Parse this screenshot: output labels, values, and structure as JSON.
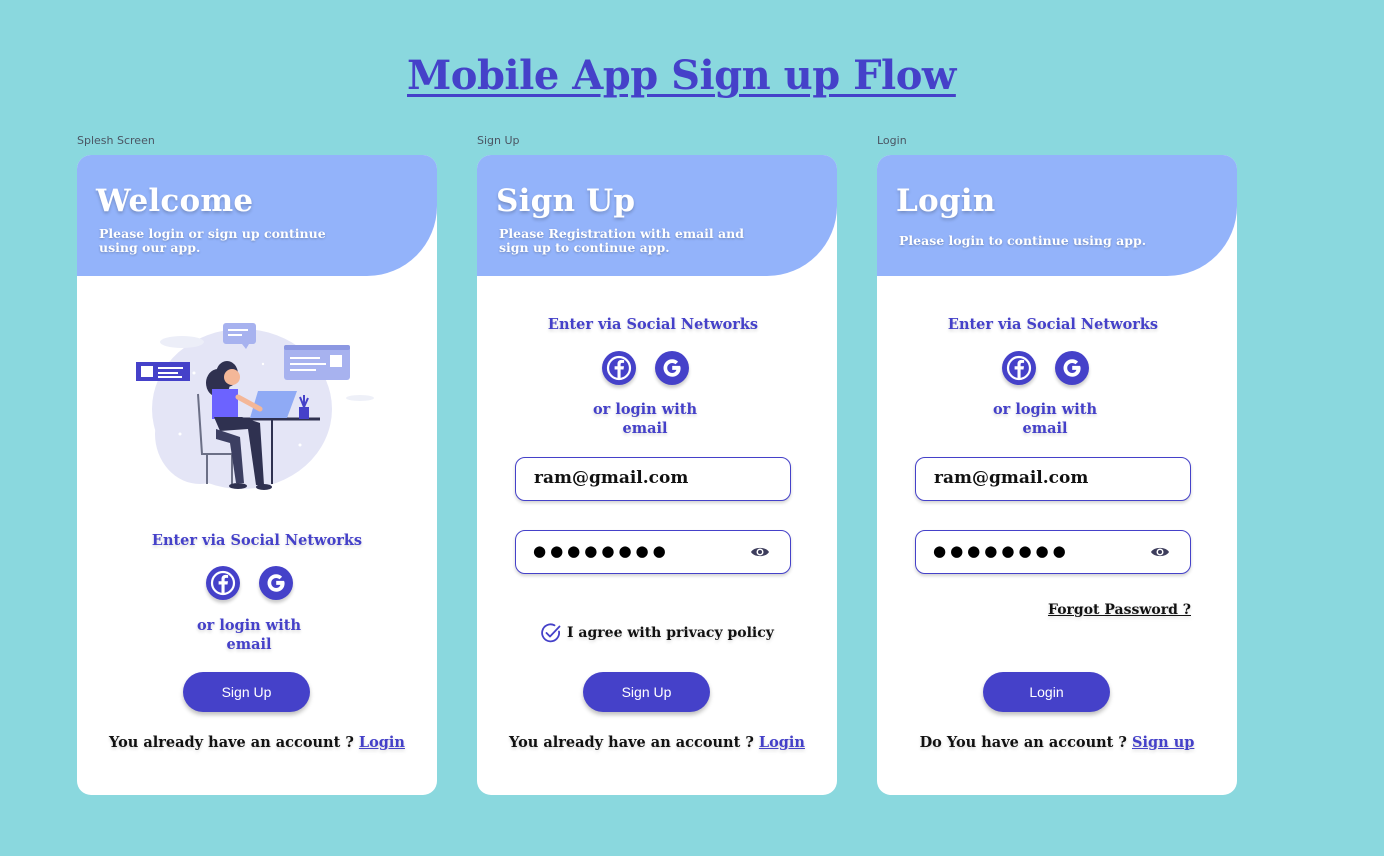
{
  "page": {
    "title": "Mobile App Sign up Flow",
    "background": "#8ad8de"
  },
  "colors": {
    "primary": "#4541c9",
    "header": "#93b3fa",
    "card": "#ffffff"
  },
  "screens": {
    "splash": {
      "frame_label": "Splesh Screen",
      "title": "Welcome",
      "subtitle": "Please login or sign up continue using our app.",
      "illustration": "woman-working-on-laptop-illustration",
      "social_heading": "Enter via Social Networks",
      "social_icons": [
        "facebook-icon",
        "google-icon"
      ],
      "or_email": "or login with email",
      "primary_button": "Sign Up",
      "account_prompt": "You already have an account ?",
      "account_link": "Login"
    },
    "signup": {
      "frame_label": "Sign Up",
      "title": "Sign Up",
      "subtitle": "Please Registration with email and sign up to continue app.",
      "social_heading": "Enter via Social Networks",
      "social_icons": [
        "facebook-icon",
        "google-icon"
      ],
      "or_email": "or login with email",
      "email_value": "ram@gmail.com",
      "password_mask": "●●●●●●●●",
      "password_toggle_icon": "eye-icon",
      "agree_text": "I agree with privacy policy",
      "agree_icon": "check-circle-icon",
      "primary_button": "Sign Up",
      "account_prompt": "You already have an account ?",
      "account_link": "Login"
    },
    "login": {
      "frame_label": "Login",
      "title": "Login",
      "subtitle": "Please login to continue using app.",
      "social_heading": "Enter via Social Networks",
      "social_icons": [
        "facebook-icon",
        "google-icon"
      ],
      "or_email": "or login with email",
      "email_value": "ram@gmail.com",
      "password_mask": "●●●●●●●●",
      "password_toggle_icon": "eye-icon",
      "forgot_link": "Forgot Password ?",
      "primary_button": "Login",
      "account_prompt": "Do You have an account ?",
      "account_link": "Sign up"
    }
  }
}
